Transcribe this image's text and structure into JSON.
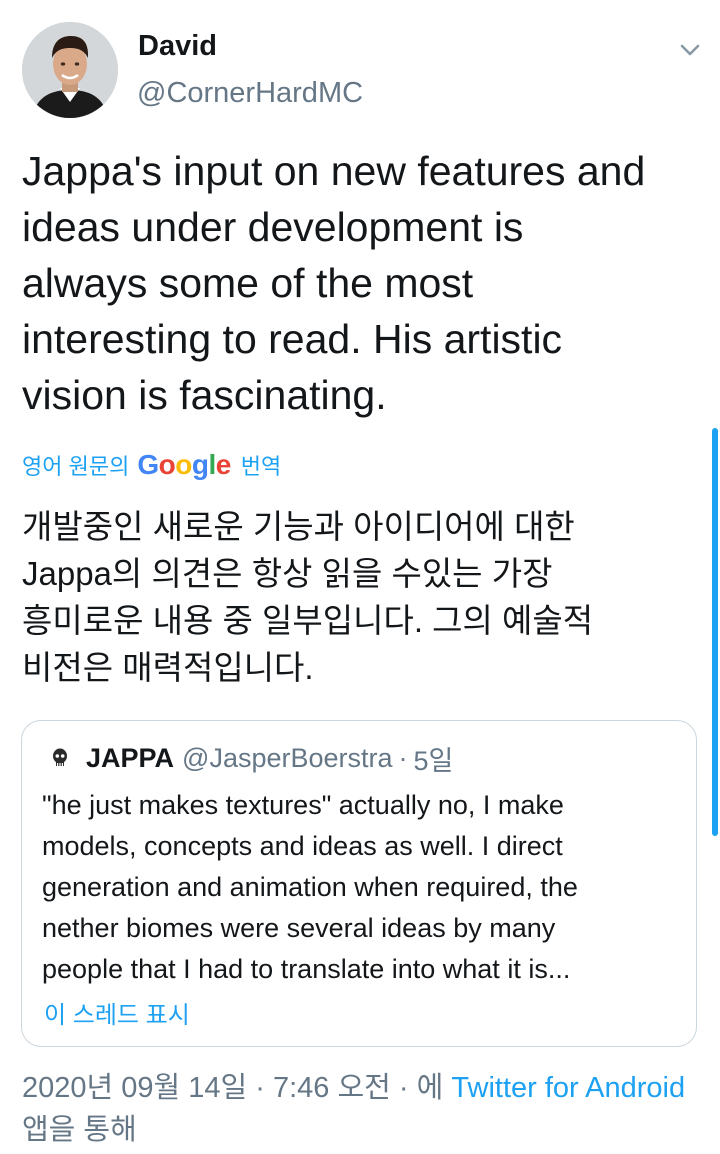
{
  "tweet": {
    "author": {
      "display_name": "David",
      "handle": "@CornerHardMC",
      "avatar_icon": "profile-photo"
    },
    "menu_icon": "chevron-down-icon",
    "text_lines": [
      "Jappa's input on new features and",
      "ideas under development is",
      "always some of the most",
      "interesting to read. His artistic",
      "vision is fascinating."
    ],
    "translation": {
      "prefix": "영어 원문의",
      "provider": {
        "letters": [
          "G",
          "o",
          "o",
          "g",
          "l",
          "e"
        ],
        "colors": [
          "#4285f4",
          "#ea4335",
          "#fbbc05",
          "#4285f4",
          "#34a853",
          "#ea4335"
        ]
      },
      "suffix": "번역",
      "text_lines": [
        "개발중인 새로운 기능과 아이디어에 대한",
        "Jappa의 의견은 항상 읽을 수있는 가장",
        "흥미로운 내용 중 일부입니다. 그의 예술적",
        "비전은 매력적입니다."
      ]
    },
    "quoted_tweet": {
      "name": "JAPPA",
      "handle": "@JasperBoerstra",
      "separator": "·",
      "time": "5일",
      "text_lines": [
        "\"he just makes textures\" actually no, I make",
        "models, concepts and ideas as well. I direct",
        "generation and animation when required, the",
        "nether biomes were several ideas by many",
        "people that I had to translate into what it is..."
      ],
      "show_thread_label": "이 스레드 표시"
    },
    "meta": {
      "date": "2020년 09월 14일",
      "separator": "·",
      "time": "7:46 오전",
      "via_prefix": "에",
      "client": "Twitter for Android",
      "via_suffix": "앱을 통해"
    }
  },
  "colors": {
    "link": "#1da1f2",
    "text": "#14171a",
    "secondary": "#657786",
    "border": "#ccd6dd"
  }
}
